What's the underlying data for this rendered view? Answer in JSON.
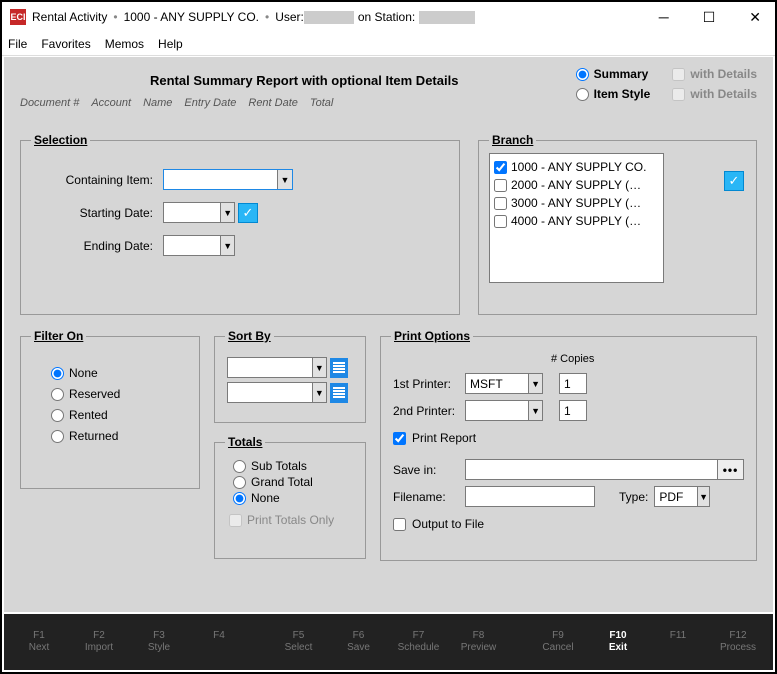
{
  "title": {
    "app": "Rental Activity",
    "company": "1000 - ANY SUPPLY CO.",
    "user_label": "User:",
    "station_label": "on Station:"
  },
  "menu": {
    "file": "File",
    "favorites": "Favorites",
    "memos": "Memos",
    "help": "Help"
  },
  "header": {
    "report_title": "Rental Summary Report with optional Item Details",
    "cols": {
      "doc": "Document #",
      "acct": "Account",
      "name": "Name",
      "entry": "Entry Date",
      "rent": "Rent Date",
      "total": "Total"
    },
    "mode": {
      "summary": "Summary",
      "item_style": "Item Style",
      "with_details": "with Details"
    }
  },
  "selection": {
    "legend": "Selection",
    "containing_item": "Containing Item:",
    "starting_date": "Starting Date:",
    "ending_date": "Ending Date:"
  },
  "branch": {
    "legend": "Branch",
    "items": [
      {
        "label": "1000 - ANY SUPPLY CO.",
        "checked": true
      },
      {
        "label": "2000 - ANY SUPPLY (…",
        "checked": false
      },
      {
        "label": "3000 - ANY SUPPLY (…",
        "checked": false
      },
      {
        "label": "4000 - ANY SUPPLY (…",
        "checked": false
      }
    ]
  },
  "filter": {
    "legend": "Filter On",
    "none": "None",
    "reserved": "Reserved",
    "rented": "Rented",
    "returned": "Returned"
  },
  "sort": {
    "legend": "Sort By"
  },
  "totals": {
    "legend": "Totals",
    "sub": "Sub Totals",
    "grand": "Grand Total",
    "none": "None",
    "print_totals_only": "Print Totals Only"
  },
  "print": {
    "legend": "Print Options",
    "printer1": "1st Printer:",
    "printer2": "2nd Printer:",
    "printer1_value": "MSFT",
    "copies_label": "# Copies",
    "copies1": "1",
    "copies2": "1",
    "print_report": "Print Report",
    "save_in": "Save in:",
    "filename": "Filename:",
    "type": "Type:",
    "type_value": "PDF",
    "output_to_file": "Output to File"
  },
  "fkeys": {
    "f1": "Next",
    "f2": "Import",
    "f3": "Style",
    "f4": "",
    "f5": "Select",
    "f6": "Save",
    "f7": "Schedule",
    "f8": "Preview",
    "f9": "Cancel",
    "f10": "Exit",
    "f11": "",
    "f12": "Process"
  }
}
